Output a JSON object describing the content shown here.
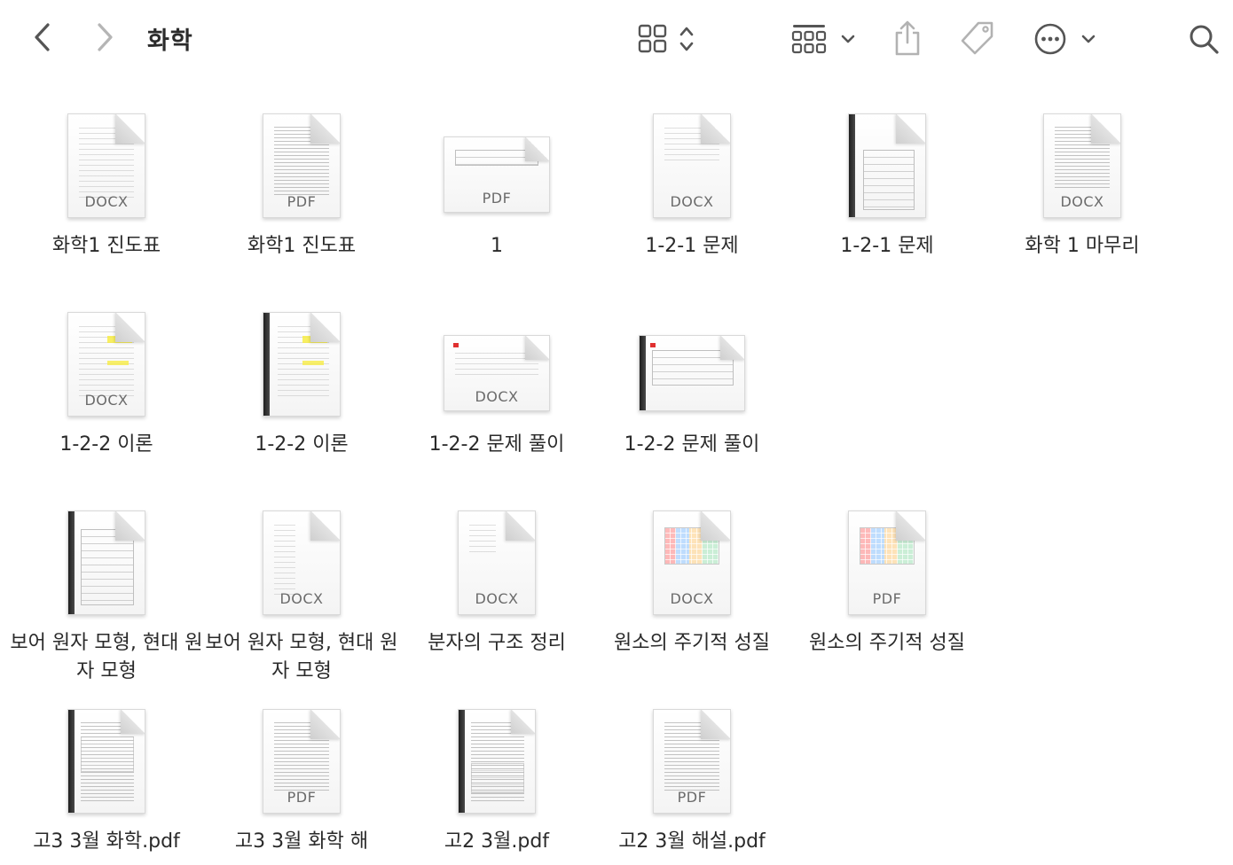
{
  "window": {
    "title": "화학"
  },
  "toolbar": {
    "icons": [
      "back-icon",
      "forward-icon",
      "grid-view-icon",
      "group-icon",
      "share-icon",
      "tag-icon",
      "more-icon",
      "search-icon"
    ]
  },
  "files": [
    {
      "name": "화학1 진도표",
      "type": "DOCX"
    },
    {
      "name": "화학1 진도표",
      "type": "PDF"
    },
    {
      "name": "1",
      "type": "PDF"
    },
    {
      "name": "1-2-1 문제",
      "type": "DOCX"
    },
    {
      "name": "1-2-1 문제",
      "type": ""
    },
    {
      "name": "화학 1 마무리",
      "type": "DOCX"
    },
    {
      "name": "1-2-2 이론",
      "type": "DOCX"
    },
    {
      "name": "1-2-2 이론",
      "type": ""
    },
    {
      "name": "1-2-2 문제 풀이",
      "type": "DOCX"
    },
    {
      "name": "1-2-2 문제 풀이",
      "type": ""
    },
    {
      "name": "보어 원자 모형, 현대 원자 모형",
      "type": ""
    },
    {
      "name": "보어 원자 모형, 현대 원자 모형",
      "type": "DOCX"
    },
    {
      "name": "분자의 구조 정리",
      "type": "DOCX"
    },
    {
      "name": "원소의 주기적 성질",
      "type": "DOCX"
    },
    {
      "name": "원소의 주기적 성질",
      "type": "PDF"
    },
    {
      "name": "고3 3월 화학.pdf",
      "type": ""
    },
    {
      "name": "고3 3월 화학 해",
      "type": "PDF"
    },
    {
      "name": "고2 3월.pdf",
      "type": ""
    },
    {
      "name": "고2 3월 해설.pdf",
      "type": "PDF"
    }
  ]
}
